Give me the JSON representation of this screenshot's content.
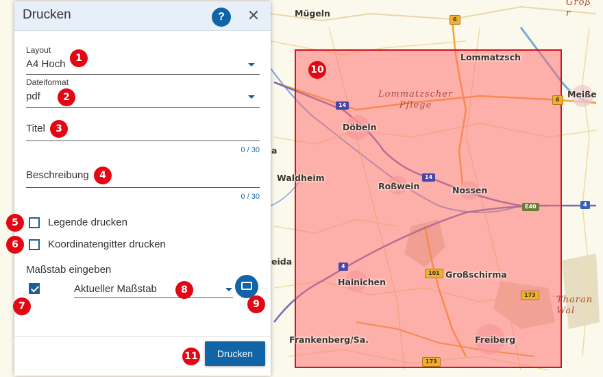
{
  "dialog": {
    "title": "Drucken",
    "help_label": "?",
    "close_label": "✕"
  },
  "form": {
    "layout_label": "Layout",
    "layout_value": "A4 Hoch",
    "format_label": "Dateiformat",
    "format_value": "pdf",
    "title_placeholder": "Titel",
    "title_counter": "0 / 30",
    "description_placeholder": "Beschreibung",
    "description_counter": "0 / 30",
    "legend_label": "Legende drucken",
    "legend_checked": false,
    "grid_label": "Koordinatengitter drucken",
    "grid_checked": false,
    "scale_heading": "Maßstab eingeben",
    "scale_checked": true,
    "scale_value": "Aktueller Maßstab",
    "print_label": "Drucken"
  },
  "badges": [
    "1",
    "2",
    "3",
    "4",
    "5",
    "6",
    "7",
    "8",
    "9",
    "10",
    "11"
  ],
  "map": {
    "places": [
      "Mügeln",
      "Lommatzsch",
      "Meiße",
      "Döbeln",
      "Waldheim",
      "Roßwein",
      "Nossen",
      "Hainichen",
      "Großschirma",
      "Frankenberg/Sa.",
      "Freiberg",
      "eida",
      "a"
    ],
    "regions": [
      "Lommatzscher\nPflege",
      "Tharan\nWal",
      "Groß\nr"
    ],
    "shields": [
      "6",
      "14",
      "6",
      "14",
      "E40",
      "4",
      "4",
      "101",
      "173",
      "173"
    ],
    "print_area_color": "#e30613"
  }
}
